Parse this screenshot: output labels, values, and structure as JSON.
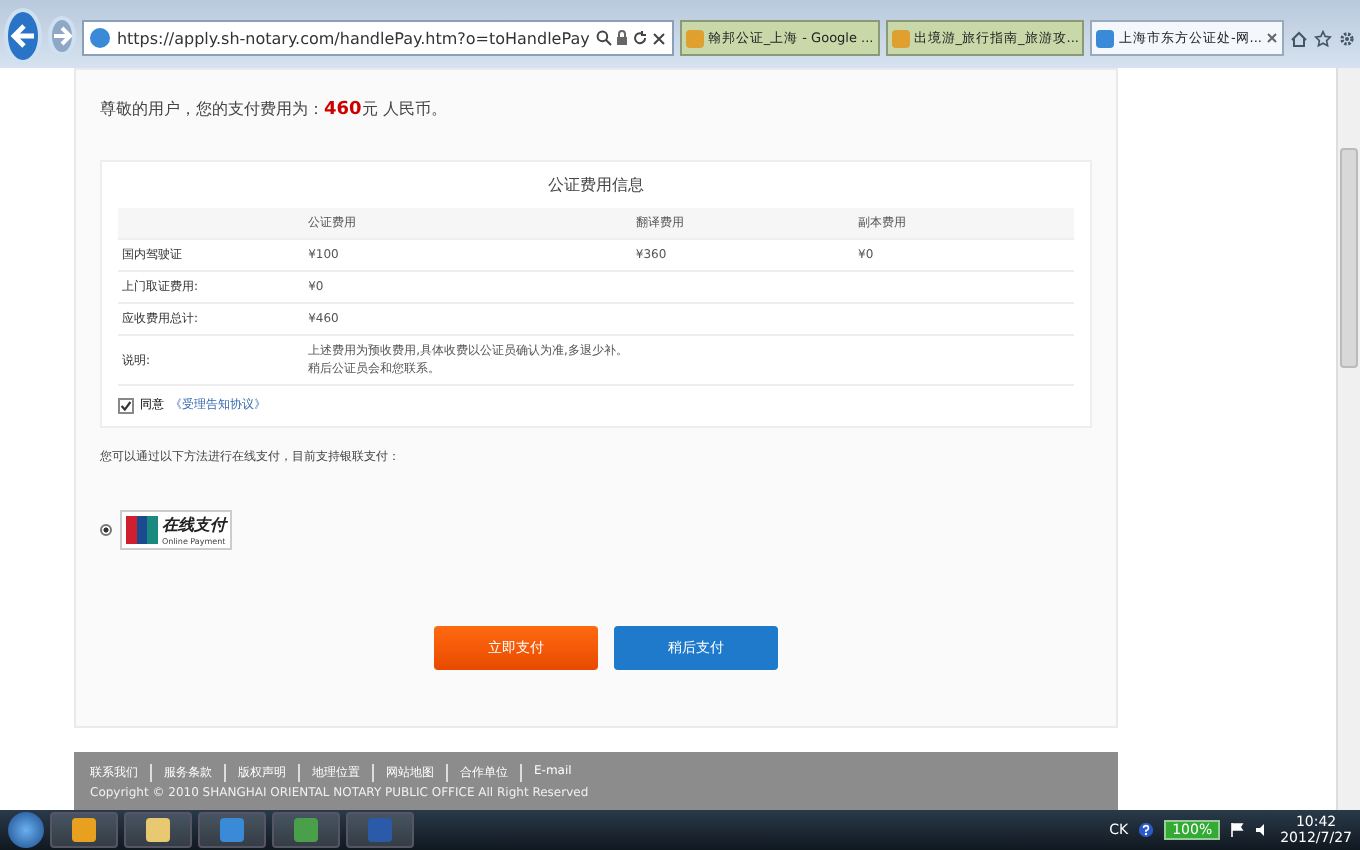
{
  "browser": {
    "url": "https://apply.sh-notary.com/handlePay.htm?o=toHandlePay",
    "tabs": [
      {
        "label": "翰邦公证_上海 - Google ...",
        "selected": false
      },
      {
        "label": "出境游_旅行指南_旅游攻...",
        "selected": false
      },
      {
        "label": "上海市东方公证处-网...",
        "selected": true
      }
    ]
  },
  "notice": "尊敬的用户，您的支付费用为：**460**元 人民币。",
  "fee_table": {
    "title": "公证费用信息",
    "columns": [
      "公证费用",
      "翻译费用",
      "副本费用"
    ],
    "rows": [
      {
        "label": "国内驾驶证",
        "cells": [
          "¥100",
          "¥360",
          "¥0"
        ]
      },
      {
        "label": "上门取证费用:",
        "cells": [
          "¥0"
        ]
      },
      {
        "label": "应收费用总计:",
        "cells": [
          "¥460"
        ]
      },
      {
        "label": "说明:",
        "lines": [
          "上述费用为预收费用,具体收费以公证员确认为准,多退少补。",
          "稍后公证员会和您联系。"
        ]
      }
    ]
  },
  "agreement": {
    "checked": true,
    "label": "同意",
    "link": "《受理告知协议》"
  },
  "payment_hint": "您可以通过以下方法进行在线支付，目前支持银联支付：",
  "payment_methods": [
    {
      "selected": true,
      "title": "在线支付",
      "subtitle": "Online Payment"
    }
  ],
  "buttons": [
    {
      "label": "立即支付",
      "kind": "primary"
    },
    {
      "label": "稍后支付",
      "kind": "secondary"
    }
  ],
  "footer": {
    "links": [
      "联系我们",
      "服务条款",
      "版权声明",
      "地理位置",
      "网站地图",
      "合作单位",
      "E-mail"
    ],
    "copyright": "Copyright © 2010 SHANGHAI ORIENTAL NOTARY PUBLIC OFFICE All Right Reserved"
  },
  "taskbar": {
    "tray_label": "CK",
    "battery": "100%",
    "time": "10:42",
    "date": "2012/7/27"
  }
}
